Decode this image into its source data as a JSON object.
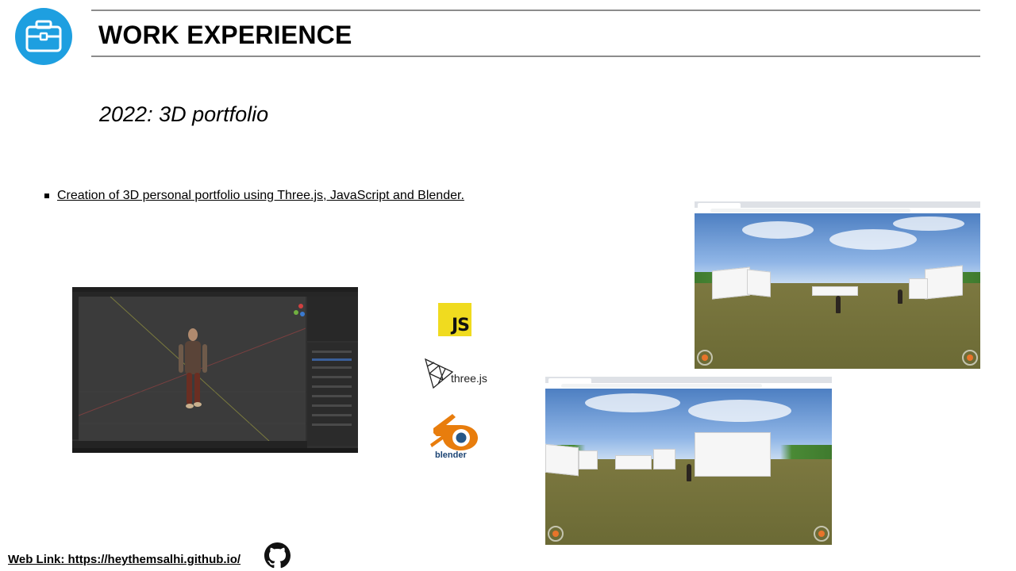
{
  "header": {
    "title": "WORK EXPERIENCE",
    "icon": "briefcase-icon",
    "accent_color": "#1e9fe0"
  },
  "subtitle": "2022: 3D portfolio",
  "bullets": [
    "Creation of 3D personal portfolio using Three.js,  JavaScript and Blender."
  ],
  "logos": {
    "javascript": "JS",
    "threejs": "three.js",
    "blender": "blender"
  },
  "footer": {
    "web_link": "Web Link: https://heythemsalhi.github.io/",
    "icon": "github-icon"
  }
}
